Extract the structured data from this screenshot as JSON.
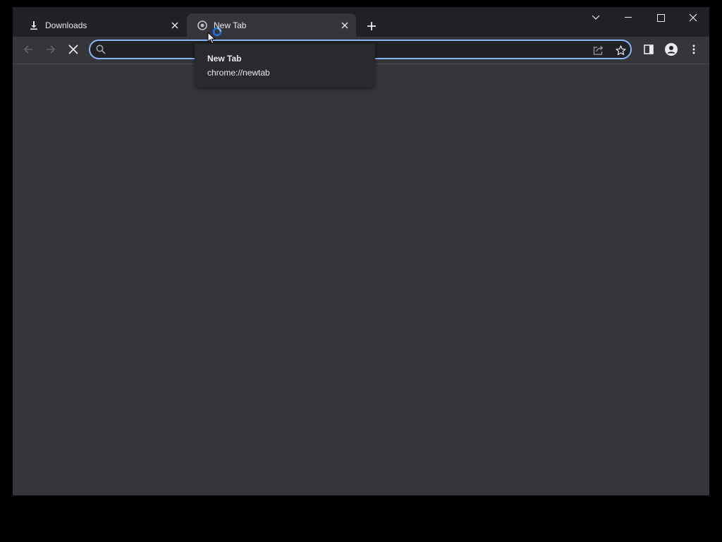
{
  "tabs": [
    {
      "title": "Downloads",
      "icon": "download-icon",
      "active": false
    },
    {
      "title": "New Tab",
      "icon": "chrome-icon",
      "active": true
    }
  ],
  "hover_card": {
    "title": "New Tab",
    "url": "chrome://newtab"
  },
  "omnibox": {
    "value": "",
    "placeholder": ""
  },
  "icons": {
    "new_tab": "plus-icon",
    "tab_search": "chevron-down-icon",
    "minimize": "minimize-icon",
    "maximize": "maximize-icon",
    "close": "close-icon",
    "back": "back-arrow-icon",
    "forward": "forward-arrow-icon",
    "stop": "stop-icon",
    "search": "search-icon",
    "share": "share-icon",
    "bookmark": "star-icon",
    "side_panel": "side-panel-icon",
    "profile": "profile-icon",
    "menu": "kebab-menu-icon"
  },
  "colors": {
    "frame": "#202124",
    "toolbar": "#35363a",
    "omnibox_focus": "#8ab4f8",
    "text": "#e8eaed",
    "icon": "#9aa0a6"
  }
}
